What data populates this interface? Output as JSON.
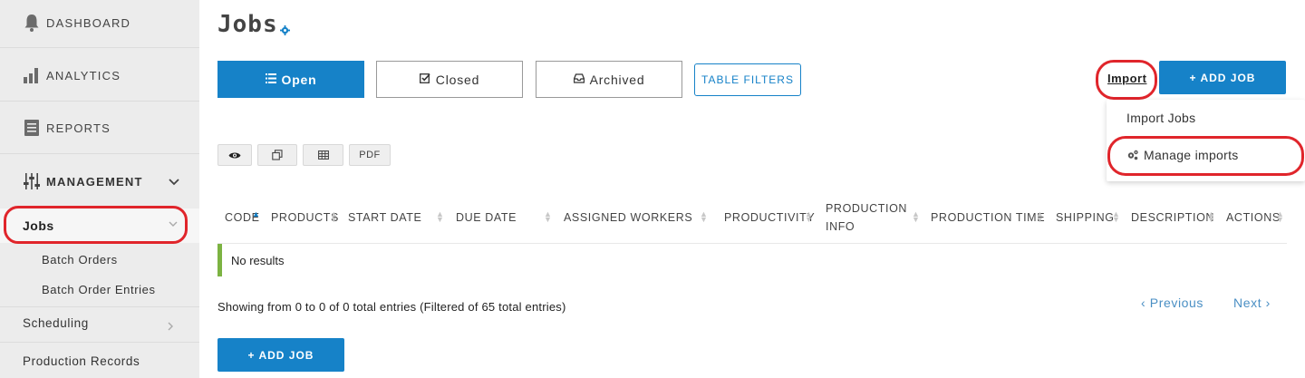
{
  "sidebar": {
    "dashboard": "DASHBOARD",
    "analytics": "ANALYTICS",
    "reports": "REPORTS",
    "management": "MANAGEMENT",
    "jobs": "Jobs",
    "batch_orders": "Batch Orders",
    "batch_order_entries": "Batch Order Entries",
    "scheduling": "Scheduling",
    "production_records": "Production Records"
  },
  "page": {
    "title": "Jobs"
  },
  "tabs": {
    "open": "Open",
    "closed": "Closed",
    "archived": "Archived",
    "table_filters": "TABLE FILTERS"
  },
  "actions": {
    "import": "Import",
    "add_job": "+ ADD JOB"
  },
  "import_menu": {
    "import_jobs": "Import Jobs",
    "manage_imports": "Manage imports"
  },
  "toolbar": {
    "pdf": "PDF"
  },
  "table": {
    "columns": [
      "CODE",
      "PRODUCTS",
      "START DATE",
      "DUE DATE",
      "ASSIGNED WORKERS",
      "PRODUCTIVITY",
      "PRODUCTION",
      "INFO",
      "PRODUCTION TIME",
      "SHIPPING",
      "DESCRIPTION",
      "ACTIONS"
    ],
    "no_results": "No results",
    "showing": "Showing from 0 to 0 of 0 total entries (Filtered of 65 total entries)"
  },
  "pagination": {
    "previous": "‹ Previous",
    "next": "Next ›"
  },
  "colors": {
    "primary": "#1682c8",
    "highlight_ring": "#e0252b",
    "no_results_bar": "#7cb342",
    "sidebar_bg": "#ececec"
  }
}
